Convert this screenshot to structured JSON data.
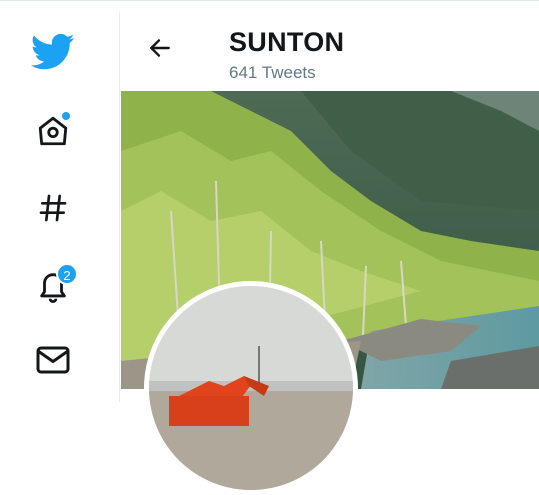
{
  "header": {
    "title": "SUNTON",
    "subtitle": "641 Tweets"
  },
  "sidebar": {
    "items": [
      {
        "icon": "twitter-bird-icon"
      },
      {
        "icon": "home-icon",
        "has_dot": true
      },
      {
        "icon": "hashtag-icon"
      },
      {
        "icon": "bell-icon",
        "badge": "2"
      },
      {
        "icon": "mail-icon"
      }
    ]
  },
  "colors": {
    "accent": "#1da1f2",
    "title": "#14171a",
    "muted": "#657786"
  }
}
